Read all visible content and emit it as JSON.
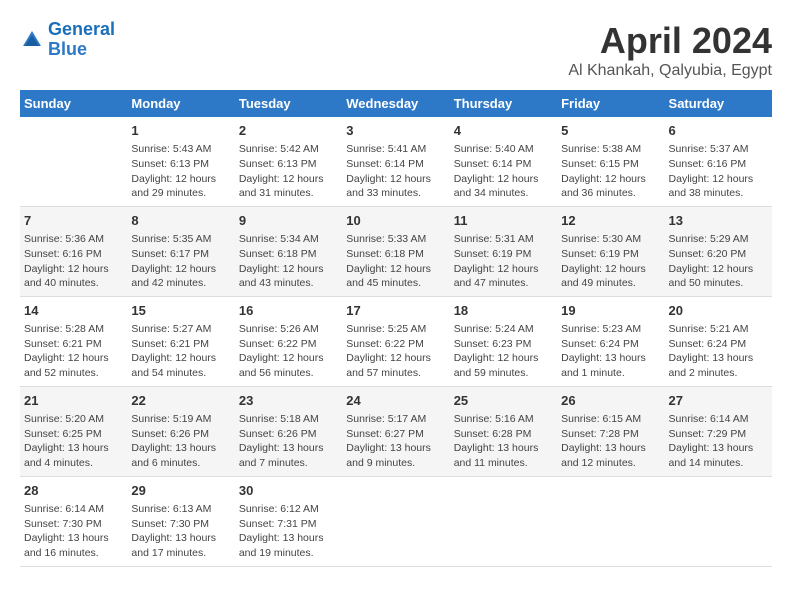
{
  "header": {
    "logo_line1": "General",
    "logo_line2": "Blue",
    "month": "April 2024",
    "location": "Al Khankah, Qalyubia, Egypt"
  },
  "weekdays": [
    "Sunday",
    "Monday",
    "Tuesday",
    "Wednesday",
    "Thursday",
    "Friday",
    "Saturday"
  ],
  "weeks": [
    [
      {
        "day": "",
        "info": ""
      },
      {
        "day": "1",
        "info": "Sunrise: 5:43 AM\nSunset: 6:13 PM\nDaylight: 12 hours\nand 29 minutes."
      },
      {
        "day": "2",
        "info": "Sunrise: 5:42 AM\nSunset: 6:13 PM\nDaylight: 12 hours\nand 31 minutes."
      },
      {
        "day": "3",
        "info": "Sunrise: 5:41 AM\nSunset: 6:14 PM\nDaylight: 12 hours\nand 33 minutes."
      },
      {
        "day": "4",
        "info": "Sunrise: 5:40 AM\nSunset: 6:14 PM\nDaylight: 12 hours\nand 34 minutes."
      },
      {
        "day": "5",
        "info": "Sunrise: 5:38 AM\nSunset: 6:15 PM\nDaylight: 12 hours\nand 36 minutes."
      },
      {
        "day": "6",
        "info": "Sunrise: 5:37 AM\nSunset: 6:16 PM\nDaylight: 12 hours\nand 38 minutes."
      }
    ],
    [
      {
        "day": "7",
        "info": "Sunrise: 5:36 AM\nSunset: 6:16 PM\nDaylight: 12 hours\nand 40 minutes."
      },
      {
        "day": "8",
        "info": "Sunrise: 5:35 AM\nSunset: 6:17 PM\nDaylight: 12 hours\nand 42 minutes."
      },
      {
        "day": "9",
        "info": "Sunrise: 5:34 AM\nSunset: 6:18 PM\nDaylight: 12 hours\nand 43 minutes."
      },
      {
        "day": "10",
        "info": "Sunrise: 5:33 AM\nSunset: 6:18 PM\nDaylight: 12 hours\nand 45 minutes."
      },
      {
        "day": "11",
        "info": "Sunrise: 5:31 AM\nSunset: 6:19 PM\nDaylight: 12 hours\nand 47 minutes."
      },
      {
        "day": "12",
        "info": "Sunrise: 5:30 AM\nSunset: 6:19 PM\nDaylight: 12 hours\nand 49 minutes."
      },
      {
        "day": "13",
        "info": "Sunrise: 5:29 AM\nSunset: 6:20 PM\nDaylight: 12 hours\nand 50 minutes."
      }
    ],
    [
      {
        "day": "14",
        "info": "Sunrise: 5:28 AM\nSunset: 6:21 PM\nDaylight: 12 hours\nand 52 minutes."
      },
      {
        "day": "15",
        "info": "Sunrise: 5:27 AM\nSunset: 6:21 PM\nDaylight: 12 hours\nand 54 minutes."
      },
      {
        "day": "16",
        "info": "Sunrise: 5:26 AM\nSunset: 6:22 PM\nDaylight: 12 hours\nand 56 minutes."
      },
      {
        "day": "17",
        "info": "Sunrise: 5:25 AM\nSunset: 6:22 PM\nDaylight: 12 hours\nand 57 minutes."
      },
      {
        "day": "18",
        "info": "Sunrise: 5:24 AM\nSunset: 6:23 PM\nDaylight: 12 hours\nand 59 minutes."
      },
      {
        "day": "19",
        "info": "Sunrise: 5:23 AM\nSunset: 6:24 PM\nDaylight: 13 hours\nand 1 minute."
      },
      {
        "day": "20",
        "info": "Sunrise: 5:21 AM\nSunset: 6:24 PM\nDaylight: 13 hours\nand 2 minutes."
      }
    ],
    [
      {
        "day": "21",
        "info": "Sunrise: 5:20 AM\nSunset: 6:25 PM\nDaylight: 13 hours\nand 4 minutes."
      },
      {
        "day": "22",
        "info": "Sunrise: 5:19 AM\nSunset: 6:26 PM\nDaylight: 13 hours\nand 6 minutes."
      },
      {
        "day": "23",
        "info": "Sunrise: 5:18 AM\nSunset: 6:26 PM\nDaylight: 13 hours\nand 7 minutes."
      },
      {
        "day": "24",
        "info": "Sunrise: 5:17 AM\nSunset: 6:27 PM\nDaylight: 13 hours\nand 9 minutes."
      },
      {
        "day": "25",
        "info": "Sunrise: 5:16 AM\nSunset: 6:28 PM\nDaylight: 13 hours\nand 11 minutes."
      },
      {
        "day": "26",
        "info": "Sunrise: 6:15 AM\nSunset: 7:28 PM\nDaylight: 13 hours\nand 12 minutes."
      },
      {
        "day": "27",
        "info": "Sunrise: 6:14 AM\nSunset: 7:29 PM\nDaylight: 13 hours\nand 14 minutes."
      }
    ],
    [
      {
        "day": "28",
        "info": "Sunrise: 6:14 AM\nSunset: 7:30 PM\nDaylight: 13 hours\nand 16 minutes."
      },
      {
        "day": "29",
        "info": "Sunrise: 6:13 AM\nSunset: 7:30 PM\nDaylight: 13 hours\nand 17 minutes."
      },
      {
        "day": "30",
        "info": "Sunrise: 6:12 AM\nSunset: 7:31 PM\nDaylight: 13 hours\nand 19 minutes."
      },
      {
        "day": "",
        "info": ""
      },
      {
        "day": "",
        "info": ""
      },
      {
        "day": "",
        "info": ""
      },
      {
        "day": "",
        "info": ""
      }
    ]
  ]
}
